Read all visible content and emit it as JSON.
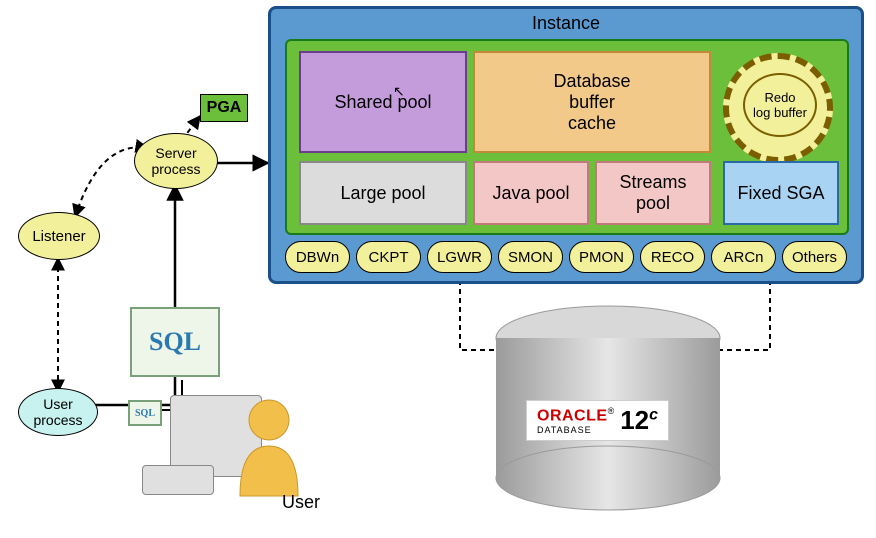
{
  "instance": {
    "title": "Instance"
  },
  "sga": {
    "shared_pool": "Shared pool",
    "db_buffer_cache": "Database\nbuffer\ncache",
    "redo_log_buffer": "Redo\nlog buffer",
    "large_pool": "Large pool",
    "java_pool": "Java pool",
    "streams_pool": "Streams\npool",
    "fixed_sga": "Fixed SGA"
  },
  "processes": [
    "DBWn",
    "CKPT",
    "LGWR",
    "SMON",
    "PMON",
    "RECO",
    "ARCn",
    "Others"
  ],
  "pga": "PGA",
  "server_process": "Server\nprocess",
  "listener": "Listener",
  "user_process": "User\nprocess",
  "sql": "SQL",
  "sql_sm": "SQL",
  "user_label": "User",
  "oracle": {
    "brand": "ORACLE",
    "sub": "DATABASE",
    "version": "12",
    "suffix": "c"
  }
}
